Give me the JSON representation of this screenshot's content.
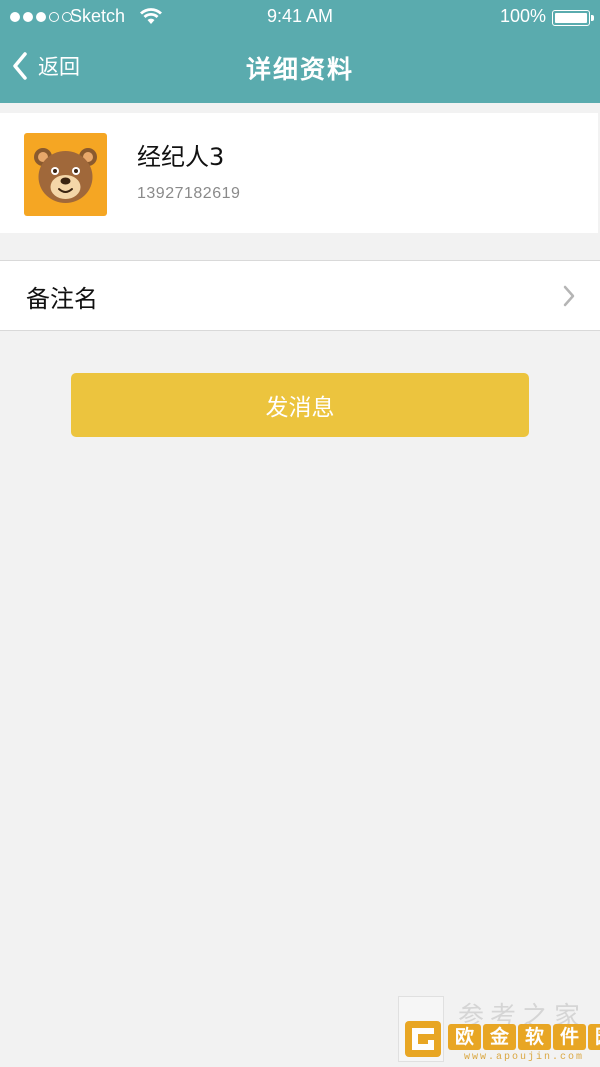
{
  "status_bar": {
    "carrier": "●●●○○ Sketch",
    "carrier_name": "Sketch",
    "time": "9:41 AM",
    "battery_percent": "100%",
    "battery_level": 1.0,
    "signal_strength_dots": 3
  },
  "nav": {
    "back_label": "返回",
    "title": "详细资料",
    "back_icon": "chevron-left-icon"
  },
  "profile": {
    "name": "经纪人3",
    "phone": "13927182619",
    "avatar_icon": "bear-avatar-icon"
  },
  "remark": {
    "label": "备注名",
    "chevron_icon": "chevron-right-icon"
  },
  "actions": {
    "send_message_label": "发消息"
  },
  "watermark": {
    "top_text": "参考之家",
    "brand_chars": [
      "欧",
      "金",
      "软",
      "件",
      "园"
    ],
    "url": "www.apoujin.com"
  },
  "colors": {
    "header": "#5aabae",
    "button": "#ecc43e",
    "avatar_bg": "#f5a623",
    "background": "#f2f2f2"
  }
}
